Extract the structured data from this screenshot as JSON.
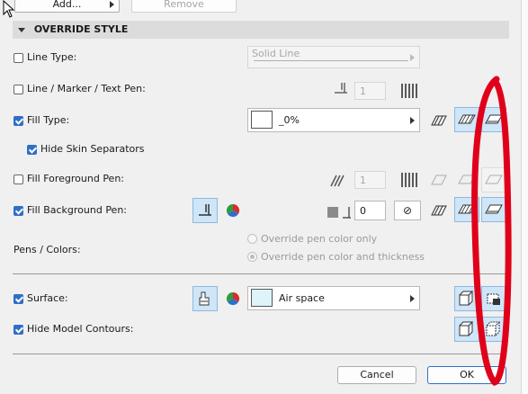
{
  "top": {
    "add_label": "Add...",
    "remove_label": "Remove"
  },
  "section": {
    "title": "OVERRIDE STYLE"
  },
  "line_type": {
    "label": "Line Type:",
    "checked": false,
    "value": "Solid Line"
  },
  "line_marker_pen": {
    "label": "Line / Marker / Text Pen:",
    "checked": false,
    "pen_value": "1"
  },
  "fill_type": {
    "label": "Fill Type:",
    "checked": true,
    "value": "_0%"
  },
  "hide_skin_separators": {
    "label": "Hide Skin Separators",
    "checked": true
  },
  "fill_foreground_pen": {
    "label": "Fill Foreground Pen:",
    "checked": false,
    "pen_value": "1"
  },
  "fill_background_pen": {
    "label": "Fill Background Pen:",
    "checked": true,
    "pen_value": "0"
  },
  "pens_colors": {
    "label": "Pens / Colors:",
    "options": [
      "Override pen color only",
      "Override pen color and thickness"
    ],
    "selected_index": 1
  },
  "surface": {
    "label": "Surface:",
    "checked": true,
    "value": "Air space",
    "swatch_color": "#dff4f8"
  },
  "hide_model_contours": {
    "label": "Hide Model Contours:",
    "checked": true
  },
  "footer": {
    "cancel_label": "Cancel",
    "ok_label": "OK"
  },
  "colors": {
    "accent": "#2f6fc7",
    "selected_icon_bg": "#cfe5f8",
    "annotation": "#e0001a"
  }
}
